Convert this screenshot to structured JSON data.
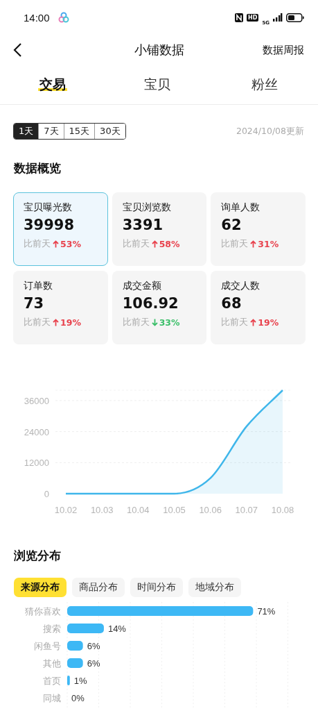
{
  "status_bar": {
    "time": "14:00",
    "badges": [
      "HD",
      "5G"
    ]
  },
  "header": {
    "title": "小铺数据",
    "action": "数据周报"
  },
  "tabs": [
    {
      "label": "交易",
      "selected": true
    },
    {
      "label": "宝贝",
      "selected": false
    },
    {
      "label": "粉丝",
      "selected": false
    }
  ],
  "periods": [
    {
      "label": "1天",
      "selected": true
    },
    {
      "label": "7天",
      "selected": false
    },
    {
      "label": "15天",
      "selected": false
    },
    {
      "label": "30天",
      "selected": false
    }
  ],
  "updated": "2024/10/08更新",
  "overview": {
    "title": "数据概览",
    "cards": [
      {
        "label": "宝贝曝光数",
        "value": "39998",
        "compare": "比前天",
        "change": "53%",
        "rising": true,
        "selected": true
      },
      {
        "label": "宝贝浏览数",
        "value": "3391",
        "compare": "比前天",
        "change": "58%",
        "rising": true,
        "selected": false
      },
      {
        "label": "询单人数",
        "value": "62",
        "compare": "比前天",
        "change": "31%",
        "rising": true,
        "selected": false
      },
      {
        "label": "订单数",
        "value": "73",
        "compare": "比前天",
        "change": "19%",
        "rising": true,
        "selected": false
      },
      {
        "label": "成交金额",
        "value": "106.92",
        "compare": "比前天",
        "change": "33%",
        "rising": false,
        "selected": false
      },
      {
        "label": "成交人数",
        "value": "68",
        "compare": "比前天",
        "change": "19%",
        "rising": true,
        "selected": false
      }
    ],
    "chart_data": {
      "type": "area",
      "x": [
        "10.02",
        "10.03",
        "10.04",
        "10.05",
        "10.06",
        "10.07",
        "10.08"
      ],
      "series": [
        {
          "color": "#3fb6ea",
          "values": [
            0,
            0,
            0,
            0,
            6000,
            26000,
            40000
          ]
        }
      ],
      "ylim": [
        0,
        40000
      ],
      "yticks": [
        0,
        12000,
        24000,
        36000
      ],
      "grid": true
    }
  },
  "distribution": {
    "title": "浏览分布",
    "chips": [
      {
        "label": "来源分布",
        "selected": true
      },
      {
        "label": "商品分布",
        "selected": false
      },
      {
        "label": "时间分布",
        "selected": false
      },
      {
        "label": "地域分布",
        "selected": false
      }
    ],
    "chart_data": {
      "type": "bar",
      "orientation": "horizontal",
      "categories": [
        "猜你喜欢",
        "搜索",
        "闲鱼号",
        "其他",
        "首页",
        "同城"
      ],
      "values": [
        71,
        14,
        6,
        6,
        1,
        0
      ],
      "value_labels": [
        "71%",
        "14%",
        "6%",
        "6%",
        "1%",
        "0%"
      ]
    }
  }
}
